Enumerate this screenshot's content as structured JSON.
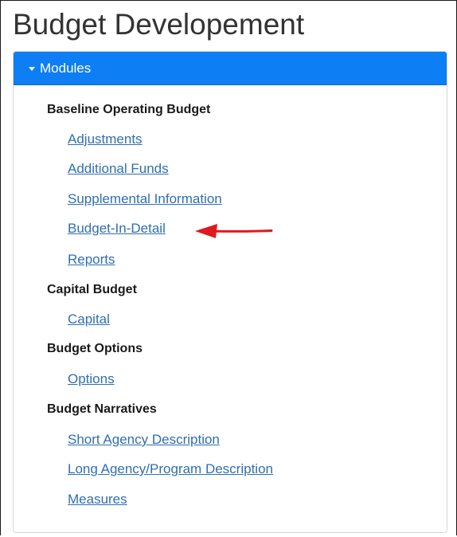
{
  "page": {
    "title": "Budget Developement"
  },
  "panel": {
    "header_label": "Modules",
    "groups": [
      {
        "title": "Baseline Operating Budget",
        "links": [
          "Adjustments",
          "Additional Funds",
          "Supplemental Information",
          "Budget-In-Detail",
          "Reports"
        ]
      },
      {
        "title": "Capital Budget",
        "links": [
          "Capital"
        ]
      },
      {
        "title": "Budget Options",
        "links": [
          "Options"
        ]
      },
      {
        "title": "Budget Narratives",
        "links": [
          "Short Agency Description",
          "Long Agency/Program Description",
          "Measures"
        ]
      }
    ]
  },
  "colors": {
    "header_background": "#0d7ef3",
    "link": "#2f6fb0",
    "annotation_arrow": "#e0191c"
  },
  "icons": {
    "header_caret": "caret-down-icon",
    "annotation": "red-arrow-pointing-left"
  }
}
